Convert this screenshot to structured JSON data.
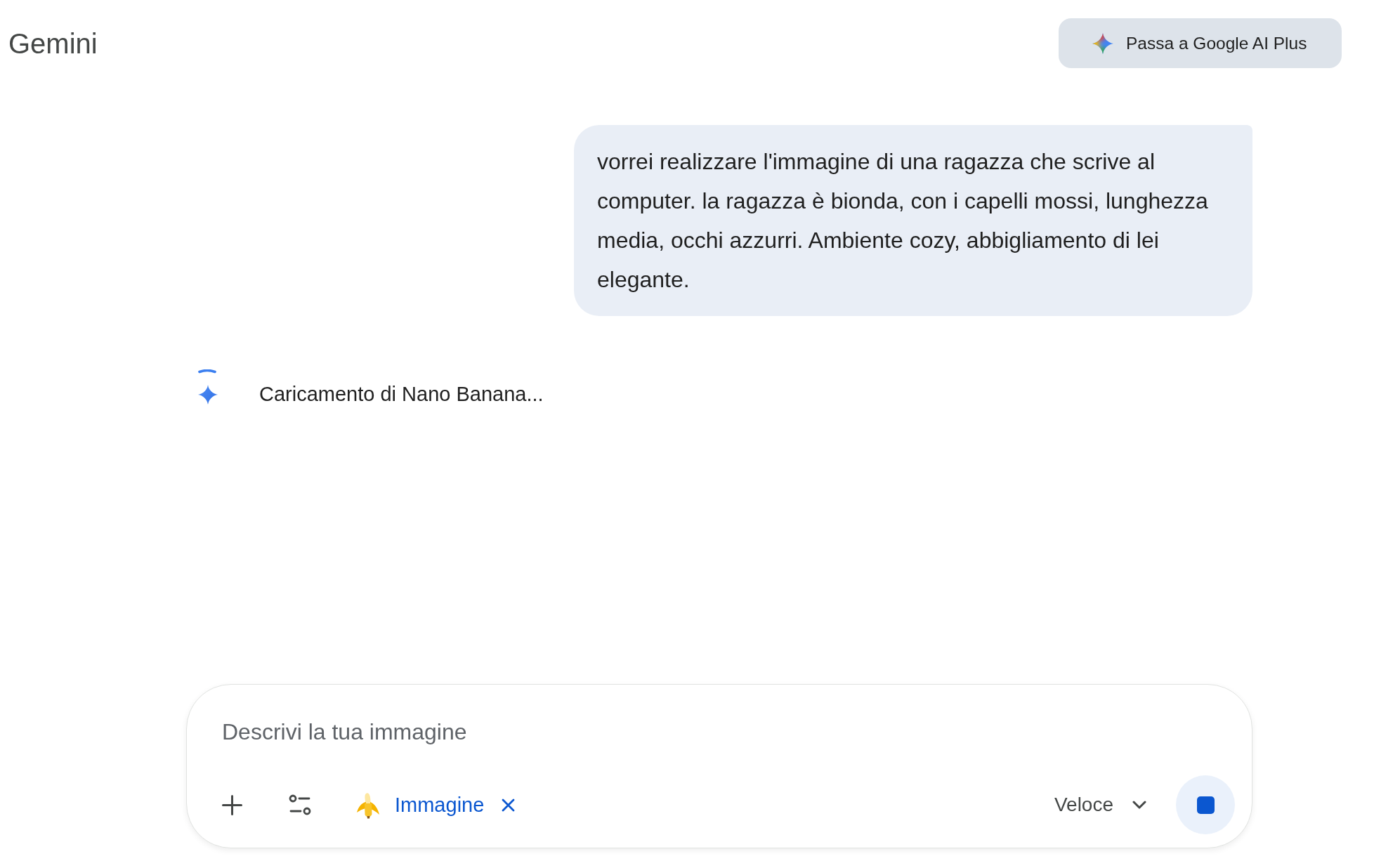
{
  "header": {
    "title": "Gemini",
    "upgrade_button": "Passa a Google AI Plus"
  },
  "conversation": {
    "user_message": "vorrei realizzare l'immagine di una ragazza che scrive al computer. la ragazza è bionda, con i capelli mossi, lunghezza media, occhi azzurri. Ambiente cozy, abbigliamento di lei elegante.",
    "response": {
      "loading": true,
      "status": "Caricamento di Nano Banana..."
    }
  },
  "composer": {
    "placeholder": "Descrivi la tua immagine",
    "tool_chip": "Immagine",
    "model_selector": "Veloce",
    "generating": true
  }
}
